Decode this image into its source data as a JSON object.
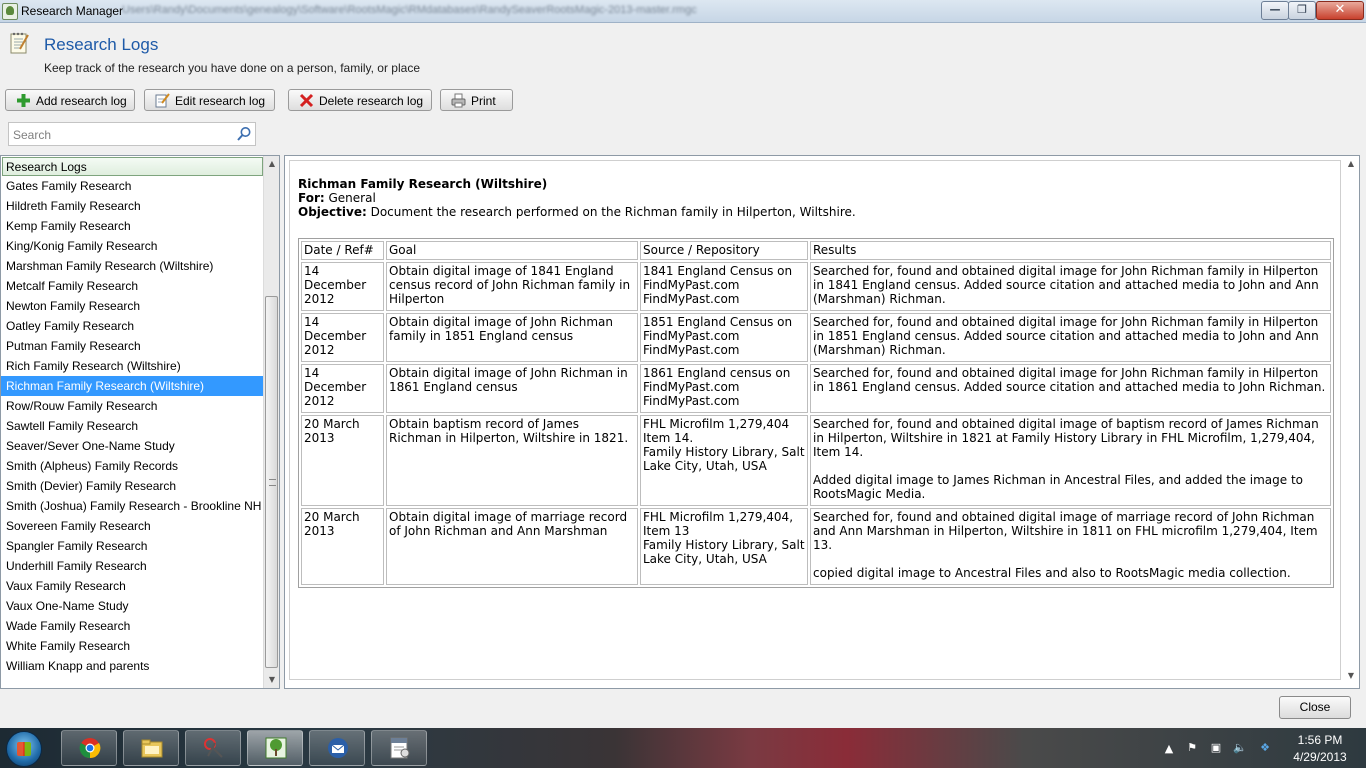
{
  "window": {
    "title": "Research Manager",
    "path": "Users\\Randy\\Documents\\genealogy\\Software\\RootsMagic\\RMdatabases\\RandySeaverRootsMagic-2013-master.rmgc",
    "minimize_glyph": "—",
    "maximize_glyph": "❐",
    "close_glyph": "✕"
  },
  "header": {
    "title": "Research Logs",
    "subtitle": "Keep track of the research you have done on a person, family, or place"
  },
  "toolbar": {
    "add_label": "Add research log",
    "edit_label": "Edit research log",
    "delete_label": "Delete research log",
    "print_label": "Print"
  },
  "search": {
    "placeholder": "Search",
    "value": ""
  },
  "list": {
    "header": "Research Logs",
    "selected_index": 10,
    "items": [
      "Gates Family Research",
      "Hildreth Family Research",
      "Kemp Family Research",
      "King/Konig Family Research",
      "Marshman Family Research (Wiltshire)",
      "Metcalf Family Research",
      "Newton Family Research",
      "Oatley Family Research",
      "Putman Family Research",
      "Rich Family Research (Wiltshire)",
      "Richman Family Research (Wiltshire)",
      "Row/Rouw Family Research",
      "Sawtell Family Research",
      "Seaver/Sever One-Name Study",
      "Smith (Alpheus) Family Records",
      "Smith (Devier) Family Research",
      "Smith (Joshua) Family Research - Brookline NH",
      "Sovereen Family Research",
      "Spangler Family Research",
      "Underhill Family Research",
      "Vaux Family Research",
      "Vaux One-Name Study",
      "Wade Family Research",
      "White Family Research",
      "William Knapp and parents"
    ]
  },
  "log": {
    "title": "Richman Family Research (Wiltshire)",
    "for_label": "For:",
    "for_value": "General",
    "objective_label": "Objective:",
    "objective_value": "Document the research performed on the Richman family in Hilperton, Wiltshire.",
    "columns": [
      "Date / Ref#",
      "Goal",
      "Source / Repository",
      "Results"
    ],
    "rows": [
      {
        "date": [
          "14 December",
          "2012"
        ],
        "goal": "Obtain digital image of 1841 England census record of John Richman family in Hilperton",
        "source": [
          "1841 England Census on",
          "FindMyPast.com",
          "FindMyPast.com"
        ],
        "results": [
          "Searched for, found and obtained digital image for John Richman family in Hilperton in 1841 England census. Added source citation and attached media to John and Ann (Marshman) Richman."
        ]
      },
      {
        "date": [
          "14 December",
          "2012"
        ],
        "goal": "Obtain digital image of John Richman family in 1851 England census",
        "source": [
          "1851 England Census on",
          "FindMyPast.com",
          "FindMyPast.com"
        ],
        "results": [
          "Searched for, found and obtained digital image for John Richman family in Hilperton in 1851 England census. Added source citation and attached media to John and Ann (Marshman) Richman."
        ]
      },
      {
        "date": [
          "14 December",
          "2012"
        ],
        "goal": "Obtain digital image of John Richman in 1861 England census",
        "source": [
          "1861 England census on",
          "FindMyPast.com",
          "FindMyPast.com"
        ],
        "results": [
          "Searched for, found and obtained digital image for John Richman family in Hilperton in 1861 England census. Added source citation and attached media to John Richman."
        ]
      },
      {
        "date": [
          "20 March",
          "2013"
        ],
        "goal": "Obtain baptism record of James Richman in Hilperton, Wiltshire in 1821.",
        "source": [
          "FHL Microfilm 1,279,404 Item 14.",
          "Family History Library, Salt Lake City, Utah, USA"
        ],
        "results": [
          "Searched for, found and obtained digital image of baptism record of James Richman in Hilperton, Wiltshire in 1821 at Family History Library in FHL Microfilm, 1,279,404, Item 14.",
          "Added digital image to James Richman in Ancestral Files, and added the image to RootsMagic Media."
        ]
      },
      {
        "date": [
          "20 March",
          "2013"
        ],
        "goal": "Obtain digital image of marriage record of John Richman and Ann Marshman",
        "source": [
          "FHL Microfilm 1,279,404, Item 13",
          "Family History Library, Salt Lake City, Utah, USA"
        ],
        "results": [
          "Searched for, found and obtained digital image of marriage record of John Richman and Ann Marshman in Hilperton, Wiltshire in 1811 on FHL microfilm 1,279,404, Item 13.",
          "copied digital image to Ancestral Files and also to RootsMagic media collection."
        ]
      }
    ]
  },
  "footer": {
    "close_label": "Close"
  },
  "taskbar": {
    "apps": [
      "chrome-icon",
      "file-explorer-icon",
      "snipping-tool-icon",
      "family-tree-icon",
      "thunderbird-icon",
      "odf-viewer-icon"
    ],
    "time": "1:56 PM",
    "date": "4/29/2013"
  },
  "colors": {
    "title_blue": "#1e5aa8",
    "selection": "#3399ff",
    "delete_red": "#d42020",
    "add_green": "#2e9a2e"
  }
}
